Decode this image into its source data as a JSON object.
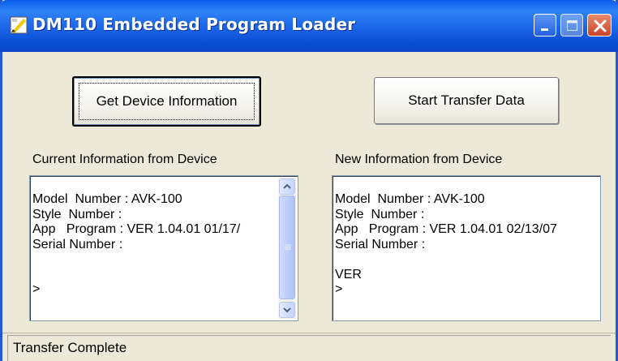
{
  "window": {
    "title": "DM110 Embedded Program Loader",
    "icon": "app-icon",
    "controls": {
      "minimize_icon": "minimize-icon",
      "maximize_icon": "maximize-icon",
      "close_icon": "close-icon"
    },
    "colors": {
      "titlebar": "#0a5ee8",
      "face": "#ece9d8",
      "close": "#c9442a"
    }
  },
  "toolbar": {
    "get_device_info_label": "Get Device Information",
    "start_transfer_label": "Start Transfer Data"
  },
  "current_panel": {
    "label": "Current Information from Device",
    "lines": [
      "Model  Number : AVK-100",
      "Style  Number :",
      "App   Program : VER 1.04.01 01/17/",
      "Serial Number :",
      "",
      "",
      ">"
    ]
  },
  "new_panel": {
    "label": "New Information from Device",
    "lines": [
      "Model  Number : AVK-100",
      "Style  Number :",
      "App   Program : VER 1.04.01 02/13/07",
      "Serial Number :",
      "",
      "VER",
      ">"
    ]
  },
  "status": {
    "text": "Transfer Complete"
  }
}
